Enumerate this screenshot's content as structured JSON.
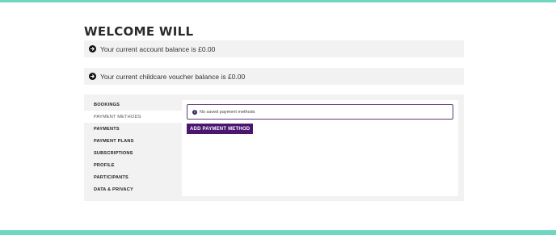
{
  "header": {
    "title": "WELCOME WILL"
  },
  "balances": [
    {
      "icon": "arrow-right-circle-icon",
      "text": "Your current account balance is £0.00"
    },
    {
      "icon": "arrow-right-circle-icon",
      "text": "Your current childcare voucher balance is £0.00"
    }
  ],
  "sidebar": {
    "items": [
      {
        "label": "BOOKINGS",
        "active": false
      },
      {
        "label": "PAYMENT METHODS",
        "active": true
      },
      {
        "label": "PAYMENTS",
        "active": false
      },
      {
        "label": "PAYMENT PLANS",
        "active": false
      },
      {
        "label": "SUBSCRIPTIONS",
        "active": false
      },
      {
        "label": "PROFILE",
        "active": false
      },
      {
        "label": "PARTICIPANTS",
        "active": false
      },
      {
        "label": "DATA & PRIVACY",
        "active": false
      }
    ]
  },
  "main": {
    "notice_icon": "info-icon",
    "notice_text": "No saved payment methods",
    "add_button_label": "ADD PAYMENT METHOD"
  },
  "colors": {
    "accent_bar": "#6fd6c0",
    "primary_button": "#4a1670",
    "notice_border": "#5b3a7a"
  }
}
